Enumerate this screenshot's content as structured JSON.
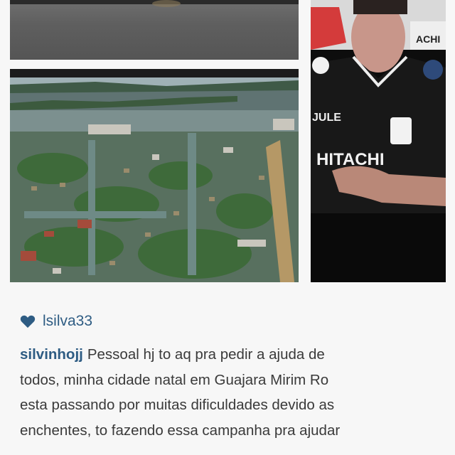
{
  "post": {
    "liker": {
      "username": "lsilva33",
      "icon": "heart-icon",
      "color": "#2e5c83"
    },
    "comment": {
      "username": "silvinhojj",
      "lines": [
        "Pessoal hj to aq pra pedir a ajuda de",
        "todos, minha cidade natal em Guajara Mirim Ro",
        "esta passando por muitas dificuldades devido as",
        "enchentes, to fazendo essa campanha pra ajudar"
      ]
    }
  },
  "player_photo": {
    "jersey_texts": [
      "HITACHI",
      "ACHI"
    ]
  },
  "colors": {
    "username": "#2e5c83",
    "text": "#3a3a3a",
    "background": "#f7f7f7"
  }
}
